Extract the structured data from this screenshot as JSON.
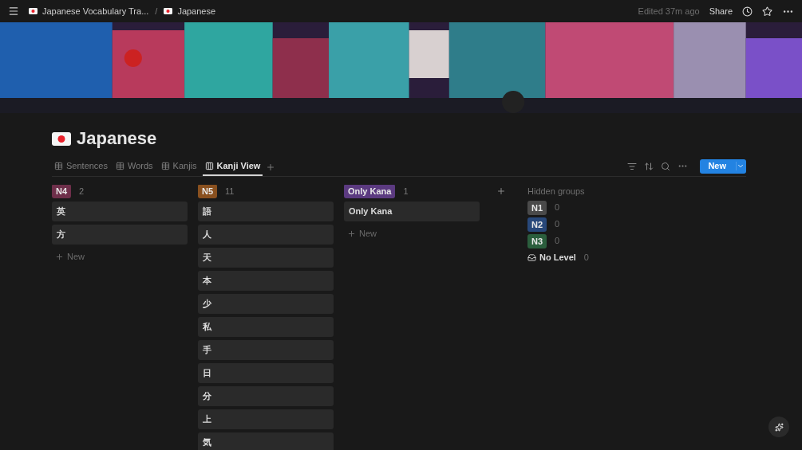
{
  "topbar": {
    "breadcrumbs": [
      {
        "label": "Japanese Vocabulary Tra..."
      },
      {
        "label": "Japanese"
      }
    ],
    "separator": "/",
    "edited": "Edited 37m ago",
    "share": "Share"
  },
  "page": {
    "title": "Japanese"
  },
  "tabs": [
    {
      "label": "Sentences",
      "kind": "table",
      "selected": false
    },
    {
      "label": "Words",
      "kind": "table",
      "selected": false
    },
    {
      "label": "Kanjis",
      "kind": "table",
      "selected": false
    },
    {
      "label": "Kanji View",
      "kind": "board",
      "selected": true
    }
  ],
  "new_button": "New",
  "columns": [
    {
      "tag": "N4",
      "color": "#6e2f4a",
      "count": "2",
      "cards": [
        "英",
        "方"
      ],
      "add_label": "New"
    },
    {
      "tag": "N5",
      "color": "#89501f",
      "count": "11",
      "cards": [
        "語",
        "人",
        "天",
        "本",
        "少",
        "私",
        "手",
        "日",
        "分",
        "上",
        "気"
      ]
    },
    {
      "tag": "Only Kana",
      "color": "#5b3a80",
      "count": "1",
      "cards": [
        "Only Kana"
      ],
      "add_label": "New"
    }
  ],
  "hidden_groups": {
    "label": "Hidden groups",
    "groups": [
      {
        "kind": "tag",
        "tag": "N1",
        "color": "#4a4a4a",
        "count": "0"
      },
      {
        "kind": "tag",
        "tag": "N2",
        "color": "#28487a",
        "count": "0"
      },
      {
        "kind": "tag",
        "tag": "N3",
        "color": "#2b5e3d",
        "count": "0"
      },
      {
        "kind": "none",
        "tag": "No Level",
        "count": "0"
      }
    ]
  }
}
